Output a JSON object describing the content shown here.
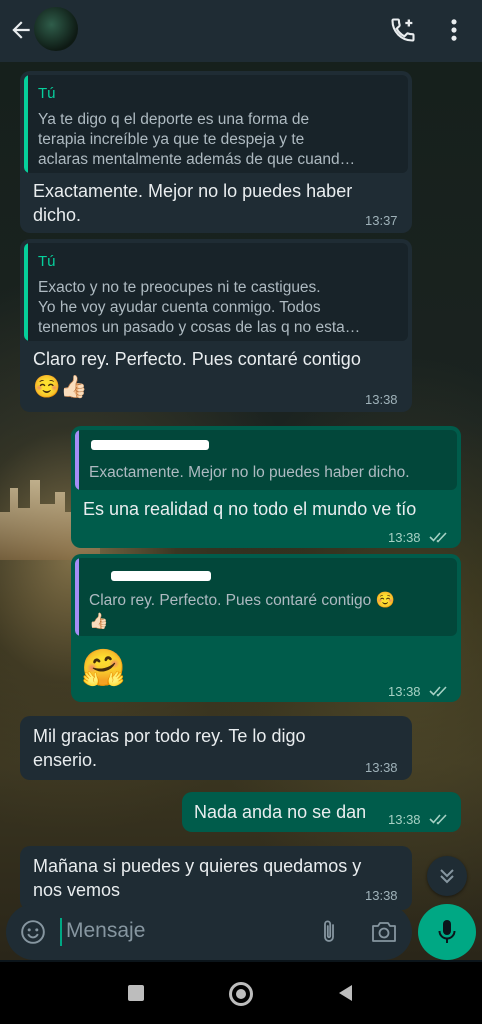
{
  "header": {
    "back_icon": "arrow-left-icon",
    "add_call_icon": "phone-plus-icon",
    "menu_icon": "more-vertical-icon"
  },
  "messages": [
    {
      "quote_name": "Tú",
      "quote_lines": [
        "Ya te digo q el deporte es una forma de",
        "terapia increíble ya que te despeja y te",
        "aclaras mentalmente además de que cuand…"
      ],
      "lines": [
        "Exactamente. Mejor no lo puedes haber",
        "dicho."
      ],
      "time": "13:37"
    },
    {
      "quote_name": "Tú",
      "quote_lines": [
        "Exacto y no te preocupes ni te castigues.",
        "Yo he voy ayudar cuenta conmigo. Todos",
        "tenemos un pasado y cosas de las q no esta…"
      ],
      "lines": [
        "Claro rey. Perfecto. Pues contaré contigo"
      ],
      "emoji": "☺️👍🏻",
      "time": "13:38"
    },
    {
      "quote_lines": [
        "Exactamente. Mejor no lo puedes haber dicho."
      ],
      "lines": [
        "Es una realidad q no todo el mundo ve tío"
      ],
      "time": "13:38"
    },
    {
      "quote_lines": [
        "Claro rey. Perfecto. Pues contaré contigo ☺️",
        "👍🏻"
      ],
      "emoji": "🤗",
      "time": "13:38"
    },
    {
      "lines": [
        "Mil gracias por todo rey. Te lo digo",
        "enserio."
      ],
      "time": "13:38"
    },
    {
      "lines": [
        "Nada anda no se dan"
      ],
      "time": "13:38"
    },
    {
      "lines": [
        "Mañana si puedes y quieres quedamos y",
        "nos vemos"
      ],
      "time": "13:38"
    }
  ],
  "composer": {
    "placeholder": "Mensaje",
    "emoji_icon": "smiley-icon",
    "attach_icon": "paperclip-icon",
    "camera_icon": "camera-icon",
    "mic_icon": "microphone-icon"
  },
  "colors": {
    "header_bg": "#1f2c34",
    "incoming_bubble": "#1f2c34",
    "outgoing_bubble": "#005c4b",
    "accent": "#00a884",
    "quote_self": "#06cf9c",
    "quote_other": "#a58df6"
  }
}
